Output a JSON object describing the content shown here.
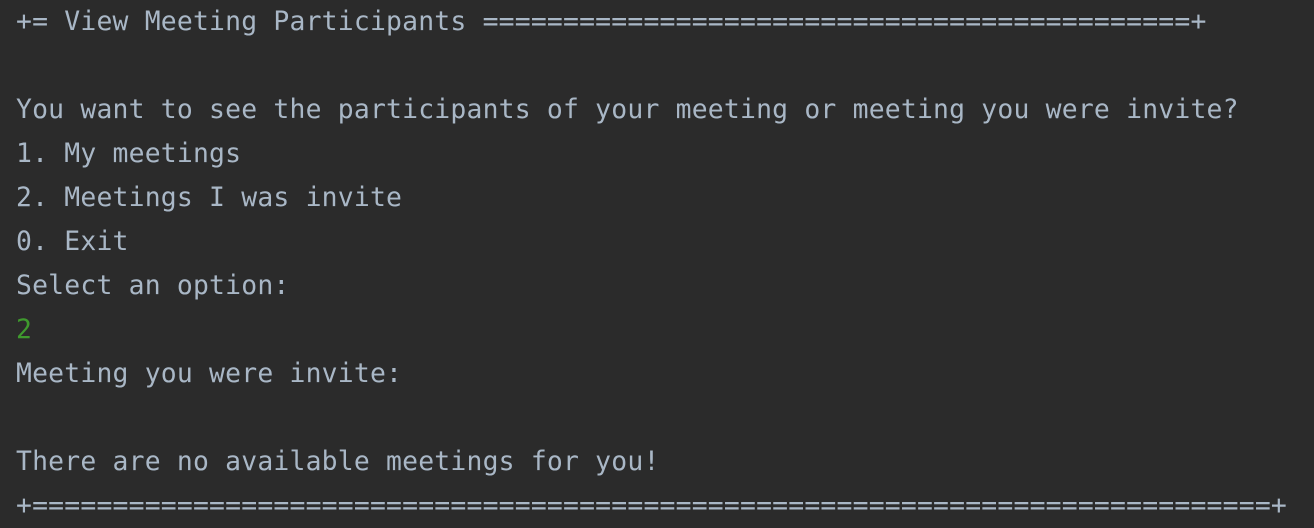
{
  "console": {
    "header_rule": "+= View Meeting Participants ============================================+",
    "question": "You want to see the participants of your meeting or meeting you were invite?",
    "options": [
      "1. My meetings",
      "2. Meetings I was invite",
      "0. Exit"
    ],
    "prompt": "Select an option:",
    "user_input": "2",
    "result_heading": "Meeting you were invite:",
    "result_message": "There are no available meetings for you!",
    "footer_rule": "+=============================================================================+"
  },
  "colors": {
    "background": "#2b2b2b",
    "text": "#a9b7c6",
    "user_input": "#3f9a2e"
  }
}
